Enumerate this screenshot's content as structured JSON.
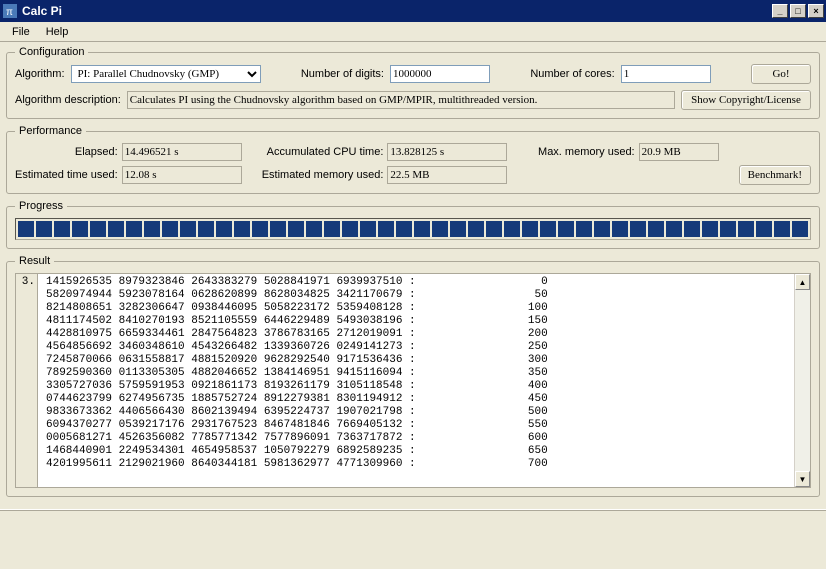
{
  "window": {
    "title": "Calc Pi"
  },
  "menu": {
    "file": "File",
    "help": "Help"
  },
  "config": {
    "legend": "Configuration",
    "algorithm_label": "Algorithm:",
    "algorithm_value": "PI: Parallel Chudnovsky (GMP)",
    "digits_label": "Number of digits:",
    "digits_value": "1000000",
    "cores_label": "Number of cores:",
    "cores_value": "1",
    "go_btn": "Go!",
    "desc_label": "Algorithm description:",
    "desc_value": "Calculates PI using the Chudnovsky algorithm based on GMP/MPIR, multithreaded version.",
    "license_btn": "Show Copyright/License"
  },
  "perf": {
    "legend": "Performance",
    "elapsed_label": "Elapsed:",
    "elapsed_value": "14.496521 s",
    "acc_label": "Accumulated CPU time:",
    "acc_value": "13.828125 s",
    "maxmem_label": "Max. memory used:",
    "maxmem_value": "20.9 MB",
    "esttime_label": "Estimated time used:",
    "esttime_value": "12.08 s",
    "estmem_label": "Estimated memory used:",
    "estmem_value": "22.5 MB",
    "bench_btn": "Benchmark!"
  },
  "progress": {
    "legend": "Progress"
  },
  "result": {
    "legend": "Result",
    "prefix": "3.",
    "lines": [
      {
        "digits": "1415926535 8979323846 2643383279 5028841971 6939937510",
        "offset": "0"
      },
      {
        "digits": "5820974944 5923078164 0628620899 8628034825 3421170679",
        "offset": "50"
      },
      {
        "digits": "8214808651 3282306647 0938446095 5058223172 5359408128",
        "offset": "100"
      },
      {
        "digits": "4811174502 8410270193 8521105559 6446229489 5493038196",
        "offset": "150"
      },
      {
        "digits": "4428810975 6659334461 2847564823 3786783165 2712019091",
        "offset": "200"
      },
      {
        "digits": "4564856692 3460348610 4543266482 1339360726 0249141273",
        "offset": "250"
      },
      {
        "digits": "7245870066 0631558817 4881520920 9628292540 9171536436",
        "offset": "300"
      },
      {
        "digits": "7892590360 0113305305 4882046652 1384146951 9415116094",
        "offset": "350"
      },
      {
        "digits": "3305727036 5759591953 0921861173 8193261179 3105118548",
        "offset": "400"
      },
      {
        "digits": "0744623799 6274956735 1885752724 8912279381 8301194912",
        "offset": "450"
      },
      {
        "digits": "9833673362 4406566430 8602139494 6395224737 1907021798",
        "offset": "500"
      },
      {
        "digits": "6094370277 0539217176 2931767523 8467481846 7669405132",
        "offset": "550"
      },
      {
        "digits": "0005681271 4526356082 7785771342 7577896091 7363717872",
        "offset": "600"
      },
      {
        "digits": "1468440901 2249534301 4654958537 1050792279 6892589235",
        "offset": "650"
      },
      {
        "digits": "4201995611 2129021960 8640344181 5981362977 4771309960",
        "offset": "700"
      }
    ]
  }
}
